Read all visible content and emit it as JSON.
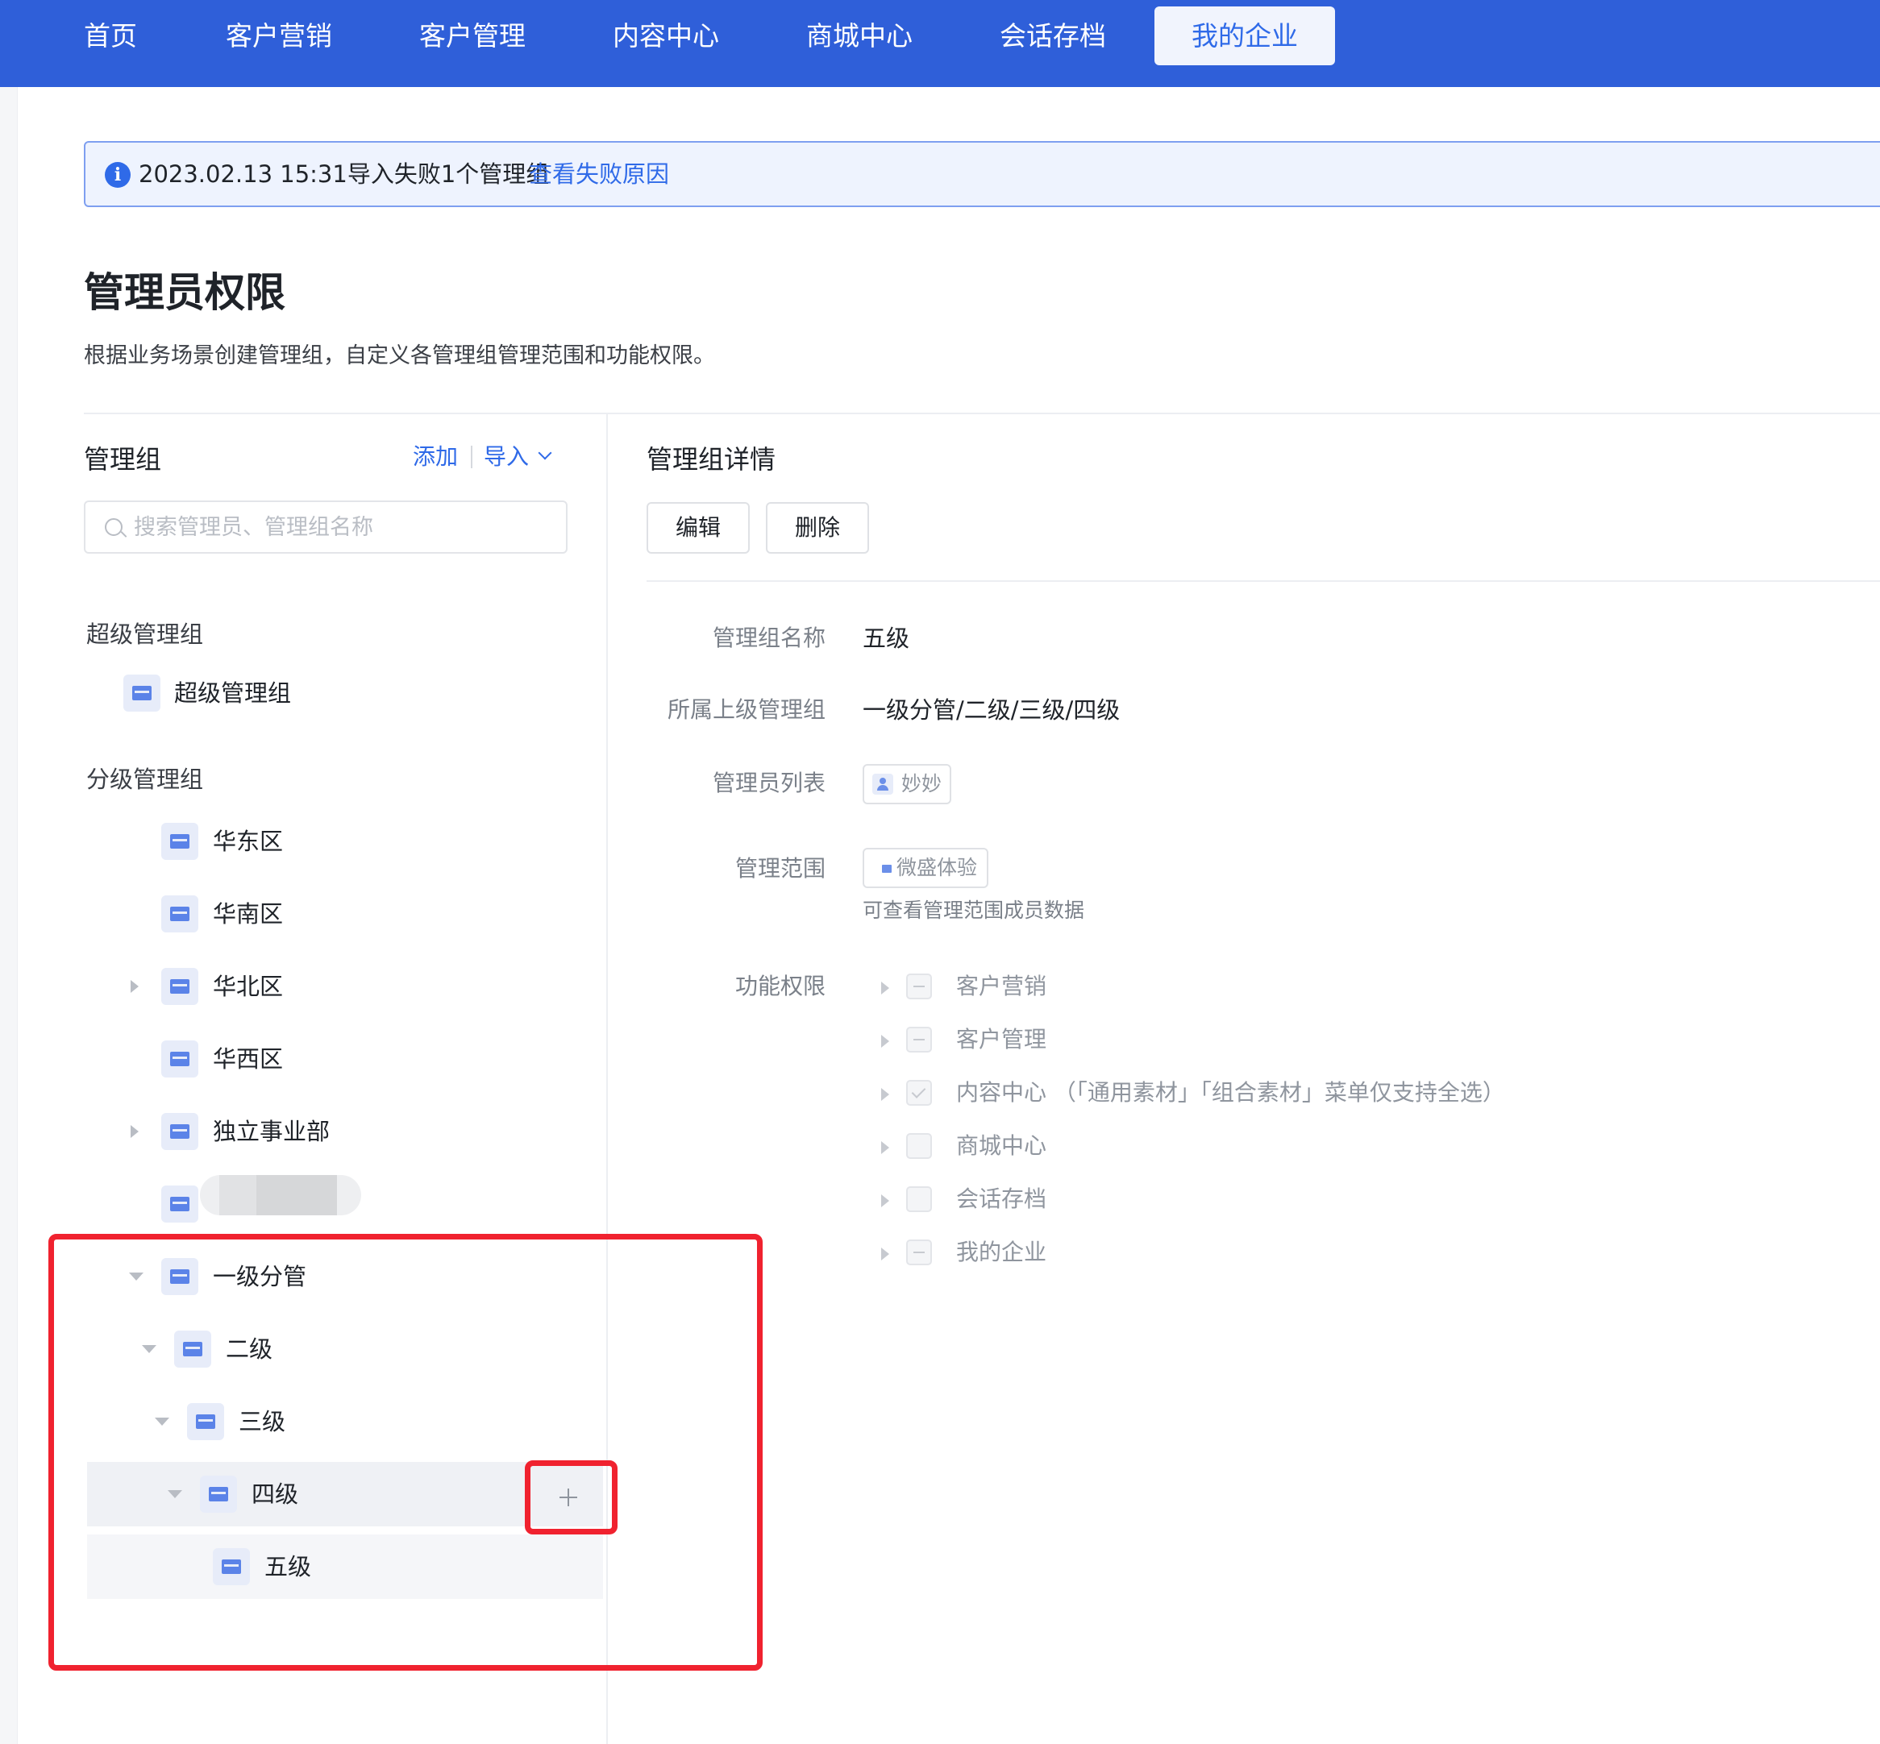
{
  "nav": {
    "items": [
      {
        "label": "首页"
      },
      {
        "label": "客户营销"
      },
      {
        "label": "客户管理"
      },
      {
        "label": "内容中心"
      },
      {
        "label": "商城中心"
      },
      {
        "label": "会话存档"
      },
      {
        "label": "我的企业",
        "active": true
      }
    ]
  },
  "notice": {
    "text": "2023.02.13 15:31导入失败1个管理组",
    "link": "查看失败原因",
    "icon": "info-icon"
  },
  "page": {
    "title": "管理员权限",
    "description": "根据业务场景创建管理组，自定义各管理组管理范围和功能权限。"
  },
  "left": {
    "title": "管理组",
    "add_label": "添加",
    "import_label": "导入",
    "search_placeholder": "搜索管理员、管理组名称",
    "super_section": "超级管理组",
    "super_node": "超级管理组",
    "sub_section": "分级管理组",
    "nodes": [
      {
        "label": "华东区",
        "expandable": false
      },
      {
        "label": "华南区",
        "expandable": false
      },
      {
        "label": "华北区",
        "expandable": true,
        "expanded": false
      },
      {
        "label": "华西区",
        "expandable": false
      },
      {
        "label": "独立事业部",
        "expandable": true,
        "expanded": false
      },
      {
        "label": "一级分管",
        "expandable": true,
        "expanded": true
      },
      {
        "label": "二级",
        "expandable": true,
        "expanded": true
      },
      {
        "label": "三级",
        "expandable": true,
        "expanded": true
      },
      {
        "label": "四级",
        "expandable": true,
        "expanded": true,
        "hovered": true
      },
      {
        "label": "五级",
        "expandable": false,
        "selected": true
      }
    ]
  },
  "right": {
    "title": "管理组详情",
    "edit_label": "编辑",
    "delete_label": "删除",
    "fields": {
      "name_label": "管理组名称",
      "name_value": "五级",
      "parent_label": "所属上级管理组",
      "parent_value": "一级分管/二级/三级/四级",
      "admins_label": "管理员列表",
      "admin_chip": "妙妙",
      "scope_label": "管理范围",
      "scope_chip": "微盛体验",
      "scope_hint": "可查看管理范围成员数据",
      "perms_label": "功能权限"
    },
    "permissions": [
      {
        "label": "客户营销",
        "state": "partial"
      },
      {
        "label": "客户管理",
        "state": "partial"
      },
      {
        "label": "内容中心 （「通用素材」「组合素材」菜单仅支持全选）",
        "state": "checked"
      },
      {
        "label": "商城中心",
        "state": "unchecked"
      },
      {
        "label": "会话存档",
        "state": "unchecked"
      },
      {
        "label": "我的企业",
        "state": "partial"
      }
    ]
  },
  "colors": {
    "nav_bg": "#2f5fd9",
    "accent": "#2f6ae8",
    "annotation": "#f0222f"
  }
}
